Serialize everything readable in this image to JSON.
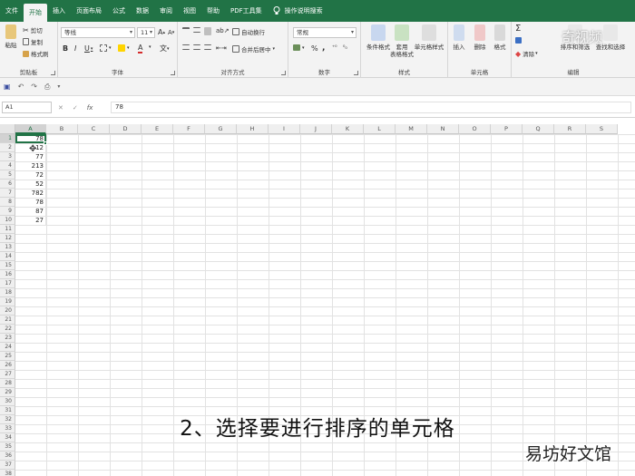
{
  "tabs": [
    "文件",
    "开始",
    "插入",
    "页面布局",
    "公式",
    "数据",
    "审阅",
    "视图",
    "帮助",
    "PDF工具集"
  ],
  "active_tab_index": 1,
  "tell_me": "操作说明搜索",
  "ribbon": {
    "clipboard": {
      "paste": "粘贴",
      "cut": "剪切",
      "copy": "复制",
      "format_painter": "格式刷",
      "label": "剪贴板"
    },
    "font": {
      "font_name": "等线",
      "font_size": "11",
      "grow": "A",
      "shrink": "A",
      "bold": "B",
      "italic": "I",
      "underline": "U",
      "wen": "文",
      "font_color": "A",
      "label": "字体"
    },
    "alignment": {
      "wrap": "自动换行",
      "merge": "合并后居中",
      "label": "对齐方式"
    },
    "number": {
      "format": "常规",
      "percent": "%",
      "comma": ",",
      "label": "数字"
    },
    "styles": {
      "conditional": "条件格式",
      "table": "套用\n表格格式",
      "cell_styles": "单元格样式",
      "label": "样式"
    },
    "cells": {
      "insert": "插入",
      "delete": "删除",
      "format": "格式",
      "label": "单元格"
    },
    "editing": {
      "sort_filter": "排序和筛选",
      "find_select": "查找和选择",
      "clear": "清除",
      "label": "编辑"
    }
  },
  "name_box": "A1",
  "formula_value": "78",
  "columns": [
    "A",
    "B",
    "C",
    "D",
    "E",
    "F",
    "G",
    "H",
    "I",
    "J",
    "K",
    "L",
    "M",
    "N",
    "O",
    "P",
    "Q",
    "R",
    "S"
  ],
  "rows": [
    "1",
    "2",
    "3",
    "4",
    "5",
    "6",
    "7",
    "8",
    "9",
    "10",
    "11",
    "12",
    "13",
    "14",
    "15",
    "16",
    "17",
    "18",
    "19",
    "20",
    "21",
    "22",
    "23",
    "24",
    "25",
    "26",
    "27",
    "28",
    "29",
    "30",
    "31",
    "32",
    "33",
    "34",
    "35",
    "36",
    "37",
    "38"
  ],
  "cell_values_A": [
    "78",
    "12",
    "77",
    "213",
    "72",
    "52",
    "782",
    "78",
    "87",
    "27"
  ],
  "caption": "2、选择要进行排序的单元格",
  "watermark_br": "易坊好文馆",
  "watermark_tr": "奇视频",
  "colors": {
    "accent": "#217346"
  }
}
